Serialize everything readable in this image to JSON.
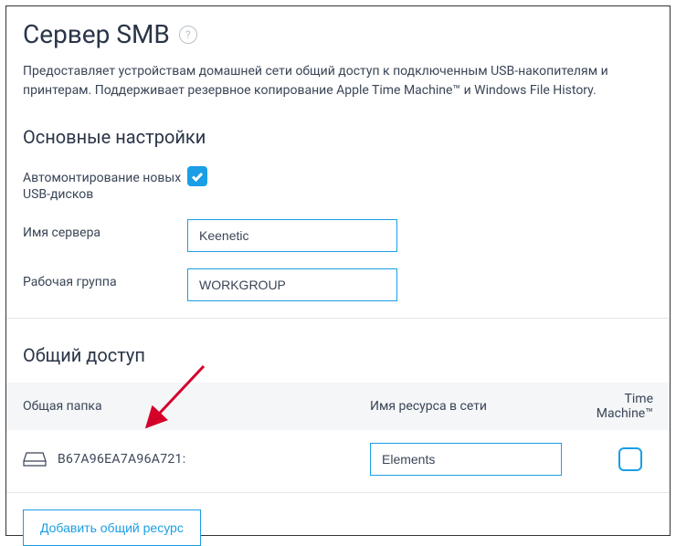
{
  "header": {
    "title": "Сервер SMB"
  },
  "description": "Предоставляет устройствам домашней сети общий доступ к подключенным USB-накопителям и принтерам. Поддерживает резервное копирование Apple Time Machine™ и Windows File History.",
  "basic_settings": {
    "title": "Основные настройки",
    "automount_label": "Автомонтирование новых USB-дисков",
    "automount_checked": true,
    "server_name_label": "Имя сервера",
    "server_name_value": "Keenetic",
    "workgroup_label": "Рабочая группа",
    "workgroup_value": "WORKGROUP"
  },
  "sharing": {
    "title": "Общий доступ",
    "col_folder": "Общая папка",
    "col_resource": "Имя ресурса в сети",
    "col_tm": "Time Machine™",
    "rows": [
      {
        "folder": "B67A96EA7A96A721:",
        "resource": "Elements",
        "tm_checked": false
      }
    ],
    "add_button": "Добавить общий ресурс"
  }
}
